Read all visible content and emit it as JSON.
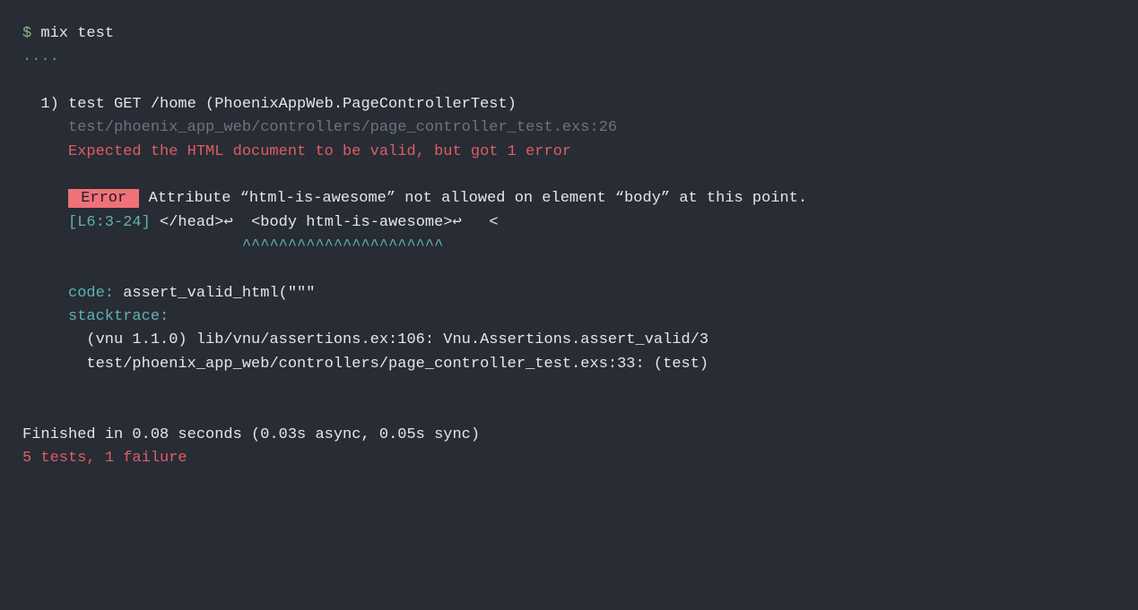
{
  "prompt": "$",
  "command": "mix test",
  "dots": "....",
  "testNumber": "1)",
  "testTitle": "test GET /home (PhoenixAppWeb.PageControllerTest)",
  "testFile": "test/phoenix_app_web/controllers/page_controller_test.exs:26",
  "expectedMsg": "Expected the HTML document to be valid, but got 1 error",
  "errorBadge": " Error ",
  "errorMsg": " Attribute “html-is-awesome” not allowed on element “body” at this point.",
  "location": "[L6:3-24]",
  "snippetPrefix": " </head>↩  <body html-is-awesome>↩   <",
  "caretsPrefix": "                   ",
  "carets": "^^^^^^^^^^^^^^^^^^^^^^",
  "codeLabel": "code:",
  "codeValue": " assert_valid_html(\"\"\"",
  "stacktraceLabel": "stacktrace:",
  "stackLine1": "(vnu 1.1.0) lib/vnu/assertions.ex:106: Vnu.Assertions.assert_valid/3",
  "stackLine2": "test/phoenix_app_web/controllers/page_controller_test.exs:33: (test)",
  "finished": "Finished in 0.08 seconds (0.03s async, 0.05s sync)",
  "summary": "5 tests, 1 failure"
}
